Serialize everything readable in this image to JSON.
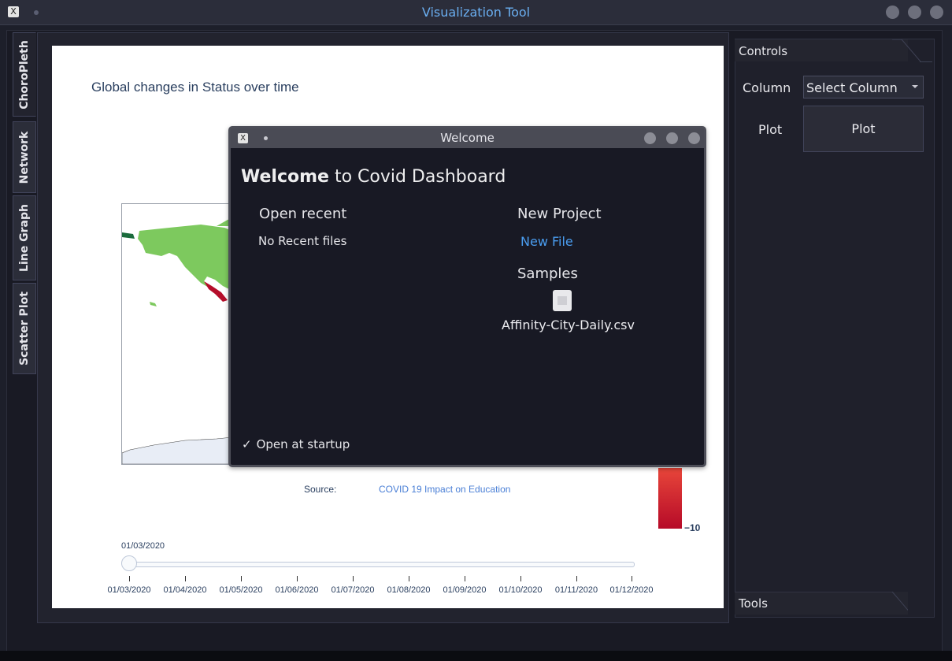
{
  "window": {
    "title": "Visualization Tool"
  },
  "side_tabs": [
    "ChoroPleth",
    "Network",
    "Line Graph",
    "Scatter Plot"
  ],
  "plot": {
    "title": "Global changes in Status over time",
    "source_label": "Source:",
    "source_link": "COVID 19 Impact on Education",
    "colorbar_tick": "−10",
    "current_date": "01/03/2020",
    "slider_position": 0,
    "slider_ticks": [
      "01/03/2020",
      "01/04/2020",
      "01/05/2020",
      "01/06/2020",
      "01/07/2020",
      "01/08/2020",
      "01/09/2020",
      "01/10/2020",
      "01/11/2020",
      "01/12/2020"
    ]
  },
  "controls": {
    "tab_label": "Controls",
    "column_label": "Column",
    "column_select_value": "Select Column",
    "plot_label": "Plot",
    "plot_button": "Plot",
    "tools_label": "Tools"
  },
  "dialog": {
    "title": "Welcome",
    "heading_bold": "Welcome",
    "heading_rest": " to Covid Dashboard",
    "open_recent_heading": "Open recent",
    "no_recent": "No Recent files",
    "new_project_heading": "New Project",
    "new_file_link": "New File",
    "samples_heading": "Samples",
    "sample_file": "Affinity-City-Daily.csv",
    "startup_check": "✓",
    "startup_label": "Open at startup"
  },
  "colors": {
    "link": "#4a9df0",
    "title_accent": "#6aaef0",
    "colorbar_top": "#e8463a",
    "colorbar_bottom": "#b60a28"
  }
}
